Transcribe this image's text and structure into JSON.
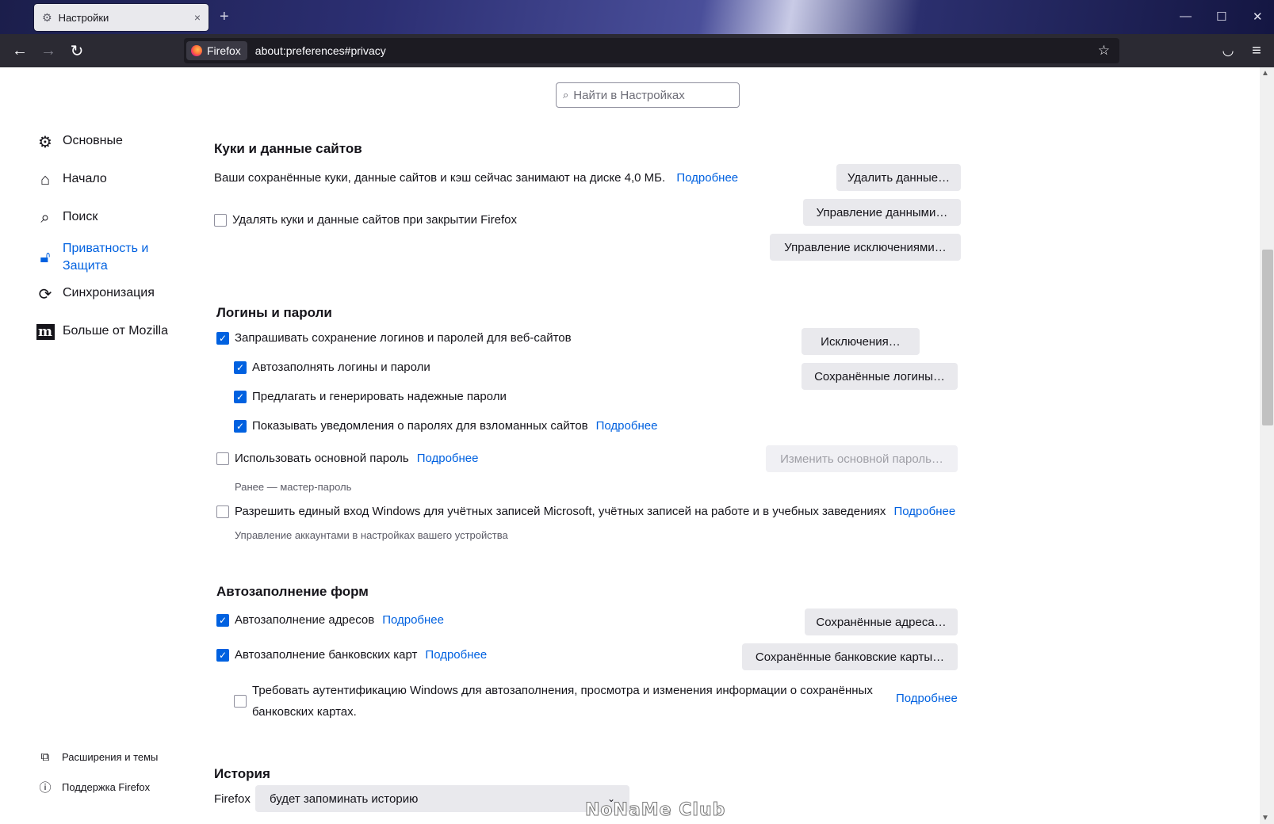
{
  "tab": {
    "title": "Настройки",
    "close": "×",
    "new_tab": "+"
  },
  "window_controls": {
    "minimize": "—",
    "maximize": "☐",
    "close": "✕"
  },
  "nav": {
    "back": "←",
    "forward": "→",
    "reload": "↻",
    "identity_label": "Firefox",
    "url": "about:preferences#privacy",
    "bookmark": "☆",
    "pocket": "◡",
    "menu": "≡"
  },
  "search": {
    "placeholder": "Найти в Настройках",
    "icon": "search-icon"
  },
  "sidebar": {
    "categories": [
      {
        "label": "Основные",
        "icon": "gear-icon"
      },
      {
        "label": "Начало",
        "icon": "home-icon"
      },
      {
        "label": "Поиск",
        "icon": "search-icon"
      },
      {
        "label_line1": "Приватность и",
        "label_line2": "Защита",
        "icon": "lock-icon",
        "selected": true
      },
      {
        "label": "Синхронизация",
        "icon": "sync-icon"
      },
      {
        "label": "Больше от Mozilla",
        "icon": "mozilla-icon",
        "icon_text": "m"
      }
    ],
    "footer": [
      {
        "label": "Расширения и темы",
        "icon": "puzzle-icon"
      },
      {
        "label": "Поддержка Firefox",
        "icon": "help-icon"
      }
    ]
  },
  "cookies": {
    "title": "Куки и данные сайтов",
    "usage_text": "Ваши сохранённые куки, данные сайтов и кэш сейчас занимают на диске 4,0 МБ.",
    "learn_more": "Подробнее",
    "delete_on_close": {
      "label": "Удалять куки и данные сайтов при закрытии Firefox",
      "checked": false
    },
    "buttons": {
      "clear": "Удалить данные…",
      "manage": "Управление данными…",
      "exceptions": "Управление исключениями…"
    }
  },
  "logins": {
    "title": "Логины и пароли",
    "ask_save": {
      "label": "Запрашивать сохранение логинов и паролей для веб-сайтов",
      "checked": true
    },
    "autofill": {
      "label": "Автозаполнять логины и пароли",
      "checked": true
    },
    "suggest": {
      "label": "Предлагать и генерировать надежные пароли",
      "checked": true
    },
    "breach": {
      "label": "Показывать уведомления о паролях для взломанных сайтов",
      "checked": true,
      "link": "Подробнее"
    },
    "primary": {
      "label": "Использовать основной пароль",
      "checked": false,
      "link": "Подробнее"
    },
    "primary_note": "Ранее — мастер-пароль",
    "sso": {
      "label": "Разрешить единый вход Windows для учётных записей Microsoft, учётных записей на работе и в учебных заведениях",
      "checked": false,
      "link": "Подробнее"
    },
    "sso_note": "Управление аккаунтами в настройках вашего устройства",
    "buttons": {
      "exceptions": "Исключения…",
      "saved": "Сохранённые логины…",
      "change_primary": "Изменить основной пароль…"
    }
  },
  "forms": {
    "title": "Автозаполнение форм",
    "addresses": {
      "label": "Автозаполнение адресов",
      "checked": true,
      "link": "Подробнее"
    },
    "cards": {
      "label": "Автозаполнение банковских карт",
      "checked": true,
      "link": "Подробнее"
    },
    "auth": {
      "label_line1": "Требовать аутентификацию Windows для автозаполнения, просмотра и изменения информации о сохранённых",
      "label_line2": "банковских картах.",
      "checked": false,
      "link": "Подробнее"
    },
    "buttons": {
      "addresses": "Сохранённые адреса…",
      "cards": "Сохранённые банковские карты…"
    }
  },
  "history": {
    "title": "История",
    "prefix": "Firefox",
    "mode": "будет запоминать историю"
  },
  "watermark": "NoNaMe Club",
  "colors": {
    "accent": "#0061e0",
    "toolbar": "#2b2a33",
    "button": "#e9e9ed"
  }
}
